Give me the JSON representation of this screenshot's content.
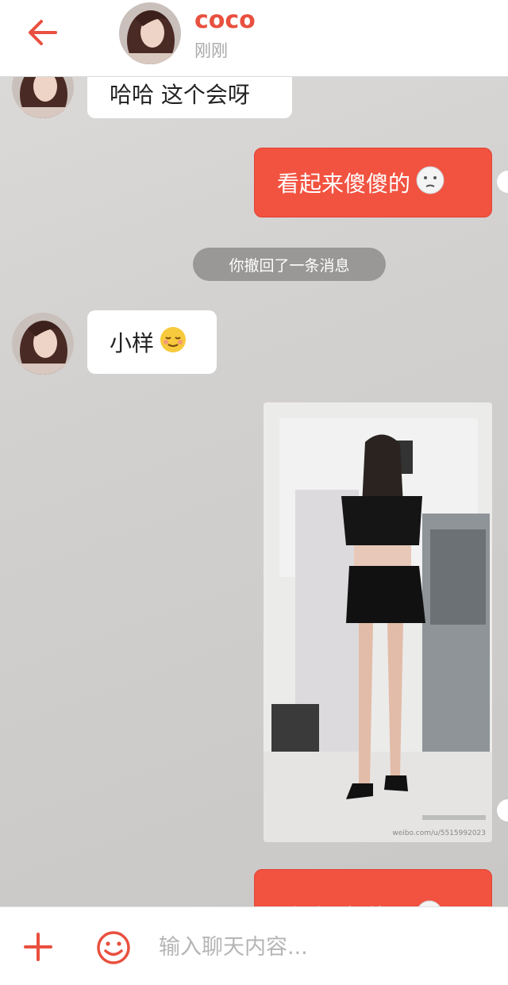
{
  "header": {
    "contact_name": "coco",
    "status": "刚刚"
  },
  "messages": [
    {
      "side": "left",
      "text": "哈哈 这个会呀"
    },
    {
      "side": "right",
      "text": "看起来傻傻的",
      "emoji": "shy-face-icon"
    },
    {
      "type": "system",
      "text": "你撤回了一条消息"
    },
    {
      "side": "left",
      "text": "小样",
      "emoji": "relieved-face-icon"
    },
    {
      "side": "right",
      "type": "image",
      "caption": "weibo.com/u/5515992023"
    },
    {
      "side": "right",
      "text": "看到心都软了",
      "emoji": "face-icon"
    }
  ],
  "input": {
    "placeholder": "输入聊天内容..."
  },
  "colors": {
    "accent": "#f25240",
    "bubble_left": "#ffffff",
    "system_pill": "#999896"
  }
}
